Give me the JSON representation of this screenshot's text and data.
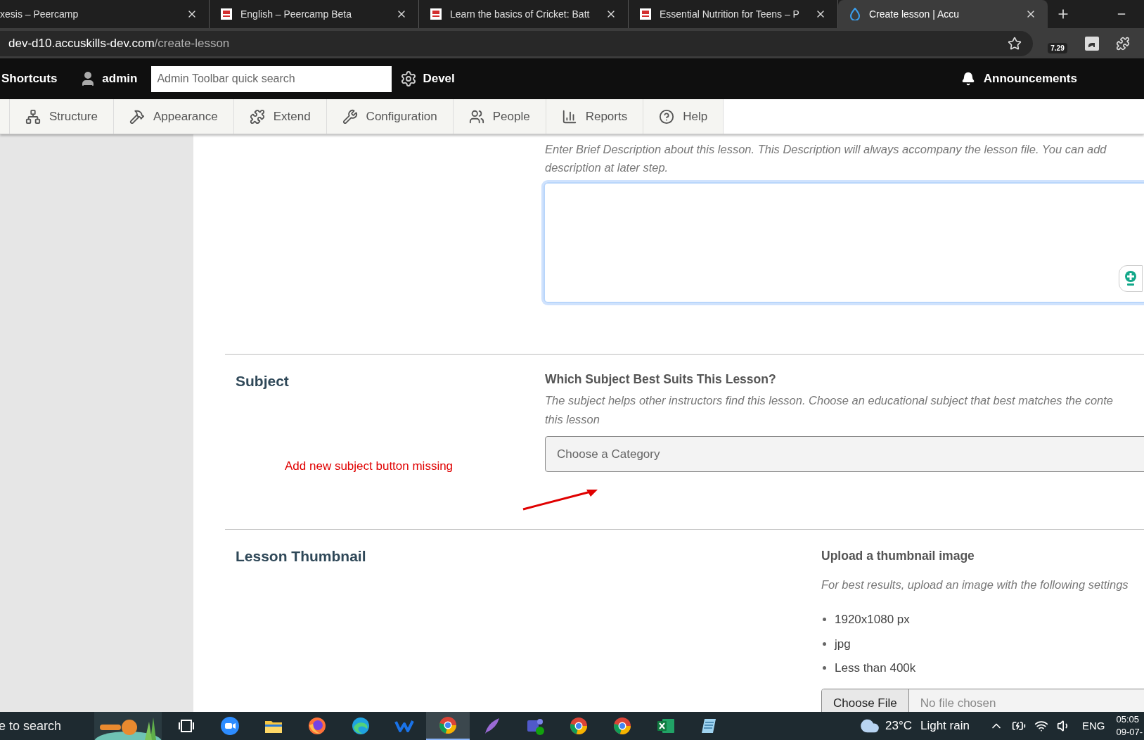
{
  "browser": {
    "tabs": [
      {
        "title": "xesis – Peercamp",
        "kind": "plain",
        "selected": false
      },
      {
        "title": "English – Peercamp Beta",
        "kind": "site",
        "selected": false
      },
      {
        "title": "Learn the basics of Cricket: Batt",
        "kind": "site",
        "selected": false
      },
      {
        "title": "Essential Nutrition for Teens – P",
        "kind": "site",
        "selected": false
      },
      {
        "title": "Create lesson | Accu",
        "kind": "drop",
        "selected": true
      }
    ],
    "address_host": "dev-d10.accuskills-dev.com",
    "address_path": "/create-lesson",
    "extension_badge": "7.29"
  },
  "admin_toolbar": {
    "shortcuts": "Shortcuts",
    "user": "admin",
    "search_placeholder": "Admin Toolbar quick search",
    "devel": "Devel",
    "announcements": "Announcements"
  },
  "tray": [
    {
      "kind": "structure",
      "label": "Structure"
    },
    {
      "kind": "appearance",
      "label": "Appearance"
    },
    {
      "kind": "extend",
      "label": "Extend"
    },
    {
      "kind": "configuration",
      "label": "Configuration"
    },
    {
      "kind": "people",
      "label": "People"
    },
    {
      "kind": "reports",
      "label": "Reports"
    },
    {
      "kind": "help",
      "label": "Help"
    }
  ],
  "description": {
    "hint": [
      "Enter Brief Description about this lesson. This Description will always accompany the lesson file. You can add",
      "description at later step."
    ]
  },
  "subject": {
    "heading": "Subject",
    "label": "Which Subject Best Suits This Lesson?",
    "hint": [
      "The subject helps other instructors find this lesson. Choose an educational subject that best matches the conte",
      "this lesson"
    ],
    "placeholder": "Choose a Category"
  },
  "annotation": "Add new subject button missing",
  "thumbnail": {
    "heading": "Lesson Thumbnail",
    "label": "Upload a thumbnail image",
    "hint": "For best results, upload an image with the following settings",
    "requirements": [
      "1920x1080 px",
      "jpg",
      "Less than 400k"
    ],
    "button": "Choose File",
    "file_status": "No file chosen"
  },
  "taskbar": {
    "search": "e to search",
    "apps": [
      {
        "kind": "taskview",
        "selected": false
      },
      {
        "kind": "zoom",
        "selected": false
      },
      {
        "kind": "files",
        "selected": false
      },
      {
        "kind": "firefox",
        "selected": false
      },
      {
        "kind": "edge",
        "selected": false
      },
      {
        "kind": "wave",
        "selected": false
      },
      {
        "kind": "chrome",
        "selected": true
      },
      {
        "kind": "feather",
        "selected": false
      },
      {
        "kind": "teams",
        "selected": false
      },
      {
        "kind": "chrome",
        "selected": false
      },
      {
        "kind": "chrome",
        "selected": false
      },
      {
        "kind": "excel",
        "selected": false
      },
      {
        "kind": "notepad",
        "selected": false
      }
    ],
    "temperature": "23°C",
    "condition": "Light rain",
    "language": "ENG",
    "time": "05:05",
    "date": "09-07-"
  }
}
